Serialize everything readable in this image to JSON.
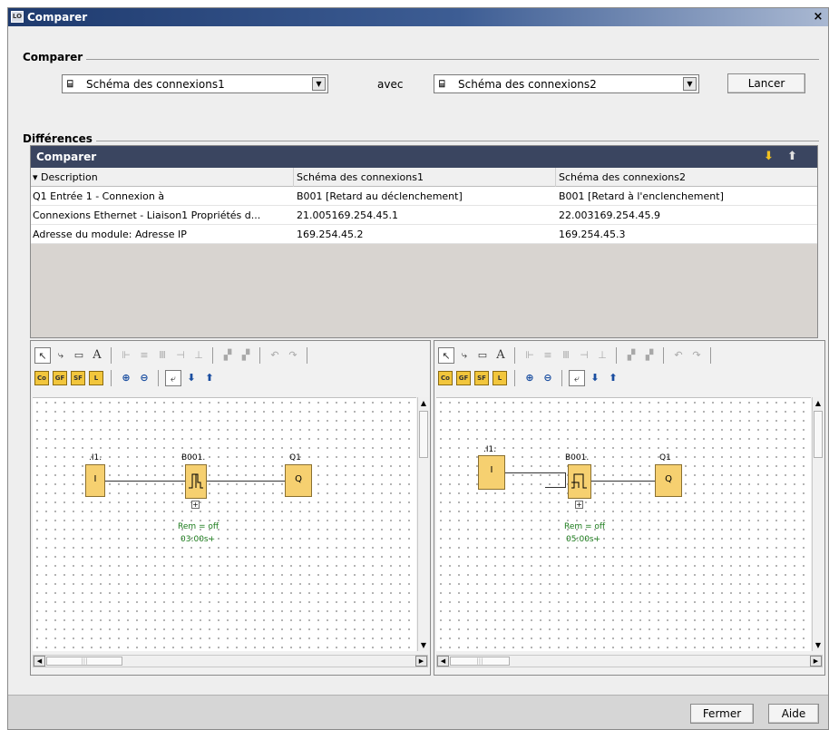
{
  "window": {
    "title": "Comparer",
    "close_glyph": "×",
    "icon": "logo-app-icon"
  },
  "compare_section": {
    "label": "Comparer",
    "left_combo": {
      "icon": "circuit-diagram-icon",
      "icon_glyph": "⌸",
      "value": "Schéma des connexions1",
      "arrow": "▼"
    },
    "avec": "avec",
    "right_combo": {
      "icon": "circuit-diagram-icon",
      "icon_glyph": "⌸",
      "value": "Schéma des connexions2",
      "arrow": "▼"
    },
    "launch_label": "Lancer"
  },
  "diff_section": {
    "label": "Différences",
    "panel_title": "Comparer",
    "nav_down": "⬇",
    "nav_up": "⬆",
    "columns": [
      "▾ Description",
      "Schéma des connexions1",
      "Schéma des connexions2"
    ],
    "rows": [
      [
        "Q1 Entrée 1 - Connexion à",
        "B001 [Retard au déclenchement]",
        "B001 [Retard à l'enclenchement]"
      ],
      [
        "Connexions Ethernet - Liaison1   Propriétés d...",
        "21.005169.254.45.1",
        "22.003169.254.45.9"
      ],
      [
        "Adresse du module:    Adresse IP",
        "169.254.45.2",
        "169.254.45.3"
      ]
    ]
  },
  "toolbar": {
    "row1": [
      "↖",
      "⤷",
      "▭",
      "A",
      "⊩",
      "≡",
      "Ⅲ",
      "⊣",
      "⊥",
      "▞",
      "▞",
      "↶",
      "↷"
    ],
    "row2": [
      "Co",
      "GF",
      "SF",
      "L",
      "⊕",
      "⊖",
      "⤶",
      "⬇",
      "⬆"
    ]
  },
  "left_diagram": {
    "input_label": ".I1.",
    "input_symbol": "I",
    "timer_label": "B001.",
    "output_label": "Q1",
    "output_symbol": "Q",
    "expand": "+",
    "param1": "Rem = off",
    "param2": "03:00s+"
  },
  "right_diagram": {
    "input_label": ".I1.",
    "input_symbol": "I",
    "timer_label": "B001.",
    "output_label": "Q1",
    "output_symbol": "Q",
    "expand": "+",
    "param1": "Rem = off",
    "param2": "05:00s+"
  },
  "scroll": {
    "up": "▲",
    "down": "▼",
    "left": "◀",
    "right": "▶",
    "grip": "|||"
  },
  "footer": {
    "close_label": "Fermer",
    "help_label": "Aide"
  }
}
